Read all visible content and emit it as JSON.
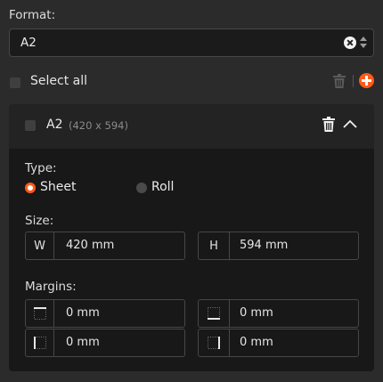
{
  "format_label": "Format:",
  "format_value": "A2",
  "select_all_label": "Select all",
  "item": {
    "name": "A2",
    "dims": "(420 x 594)"
  },
  "type_label": "Type:",
  "type_options": {
    "sheet": "Sheet",
    "roll": "Roll"
  },
  "size_label": "Size:",
  "width_prefix": "W",
  "width_value": "420 mm",
  "height_prefix": "H",
  "height_value": "594 mm",
  "margins_label": "Margins:",
  "margins": {
    "top": "0 mm",
    "bottom": "0 mm",
    "left": "0 mm",
    "right": "0 mm"
  },
  "colors": {
    "accent": "#ff5a1a",
    "background": "#2b2b2b",
    "panel": "#181818"
  },
  "icons": {
    "clear": "clear-icon",
    "stepper": "stepper-arrows-icon",
    "delete": "trash-icon",
    "add": "plus-circle-icon",
    "collapse": "chevron-up-icon"
  }
}
